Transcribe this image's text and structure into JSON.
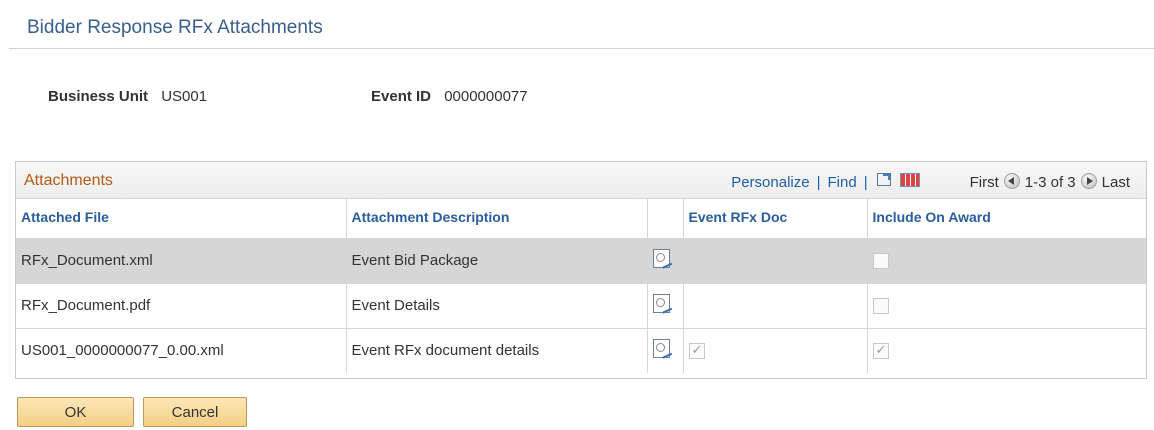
{
  "page": {
    "title": "Bidder Response RFx Attachments"
  },
  "fields": {
    "business_unit": {
      "label": "Business Unit",
      "value": "US001"
    },
    "event_id": {
      "label": "Event ID",
      "value": "0000000077"
    }
  },
  "grid": {
    "title": "Attachments",
    "nav": {
      "personalize": "Personalize",
      "separator": "|",
      "find": "Find",
      "first": "First",
      "range": "1-3 of 3",
      "last": "Last"
    },
    "columns": {
      "attached_file": "Attached File",
      "attachment_description": "Attachment Description",
      "view": "",
      "event_rfx_doc": "Event RFx Doc",
      "include_on_award": "Include On Award"
    },
    "rows": [
      {
        "file": "RFx_Document.xml",
        "description": "Event Bid Package",
        "event_rfx_doc": null,
        "include_on_award": false,
        "selected": true
      },
      {
        "file": "RFx_Document.pdf",
        "description": "Event Details",
        "event_rfx_doc": null,
        "include_on_award": false,
        "selected": false
      },
      {
        "file": "US001_0000000077_0.00.xml",
        "description": "Event RFx document details",
        "event_rfx_doc": true,
        "include_on_award": true,
        "selected": false
      }
    ]
  },
  "buttons": {
    "ok": "OK",
    "cancel": "Cancel"
  },
  "icons": {
    "view_attachment": "view-attachment-icon",
    "new_window": "new-window-icon",
    "download_grid": "download-grid-icon",
    "prev_arrow": "prev-arrow-icon",
    "next_arrow": "next-arrow-icon"
  },
  "colors": {
    "title": "#3a5e8c",
    "grid_title": "#b25a16",
    "link": "#1f5fa6",
    "selected_row": "#d6d6d6",
    "button": "#f5cf86"
  }
}
